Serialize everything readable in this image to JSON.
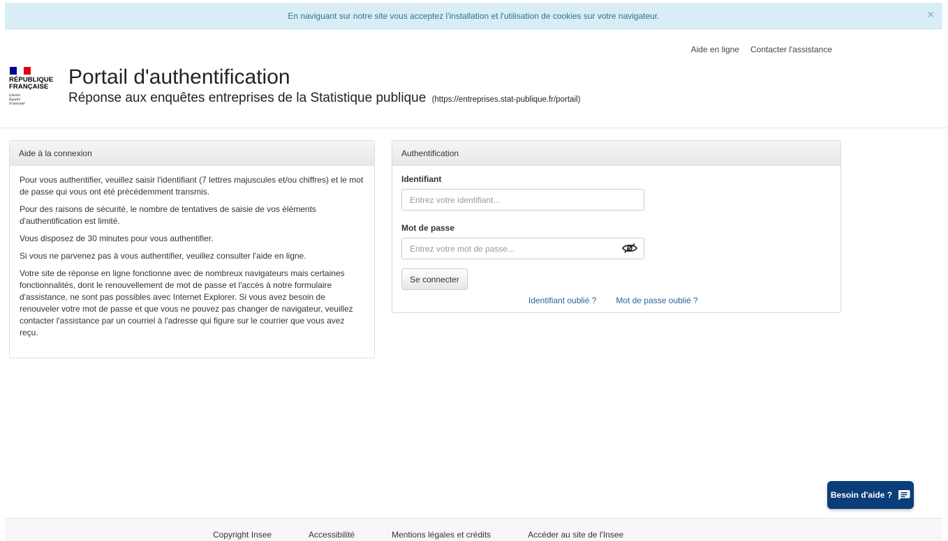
{
  "cookie_banner": {
    "message": "En naviguant sur notre site vous acceptez l'installation et l'utilisation de cookies sur votre navigateur.",
    "close_label": "×"
  },
  "top_links": {
    "help": "Aide en ligne",
    "contact": "Contacter l'assistance"
  },
  "brand": {
    "line1": "RÉPUBLIQUE",
    "line2": "FRANÇAISE",
    "motto1": "Liberté",
    "motto2": "Égalité",
    "motto3": "Fraternité",
    "flag_colors": [
      "#000091",
      "#ffffff",
      "#e1000f"
    ]
  },
  "header": {
    "title": "Portail d'authentification",
    "subtitle": "Réponse aux enquêtes entreprises de la Statistique publique",
    "url": "(https://entreprises.stat-publique.fr/portail)"
  },
  "help_panel": {
    "heading": "Aide à la connexion",
    "paragraphs": [
      "Pour vous authentifier, veuillez saisir l'identifiant (7 lettres majuscules et/ou chiffres) et le mot de passe qui vous ont été précédemment transmis.",
      "Pour des raisons de sécurité, le nombre de tentatives de saisie de vos éléments d'authentification est limité.",
      "Vous disposez de 30 minutes pour vous authentifier.",
      "Si vous ne parvenez pas à vous authentifier, veuillez consulter l'aide en ligne.",
      "Votre site de réponse en ligne fonctionne avec de nombreux navigateurs mais certaines fonctionnalités, dont le renouvellement de mot de passe et l'accès à notre formulaire d'assistance, ne sont pas possibles avec Internet Explorer. Si vous avez besoin de renouveler votre mot de passe et que vous ne pouvez pas changer de navigateur, veuillez contacter l'assistance par un courriel à l'adresse qui figure sur le courrier que vous avez reçu."
    ]
  },
  "auth_panel": {
    "heading": "Authentification",
    "identifier_label": "Identifiant",
    "identifier_placeholder": "Entrez votre identifiant...",
    "identifier_value": "",
    "password_label": "Mot de passe",
    "password_placeholder": "Entrez votre mot de passe...",
    "password_value": "",
    "password_toggle_icon": "eye-slash-icon",
    "submit_label": "Se connecter",
    "forgot_identifier": "Identifiant oublié ?",
    "forgot_password": "Mot de passe oublié ?"
  },
  "help_fab": {
    "label": "Besoin d'aide ?",
    "icon": "chat-icon",
    "color": "#0a3d79"
  },
  "footer": {
    "links": [
      "Copyright Insee",
      "Accessibilité",
      "Mentions légales et crédits",
      "Accéder au site de l'Insee"
    ]
  }
}
